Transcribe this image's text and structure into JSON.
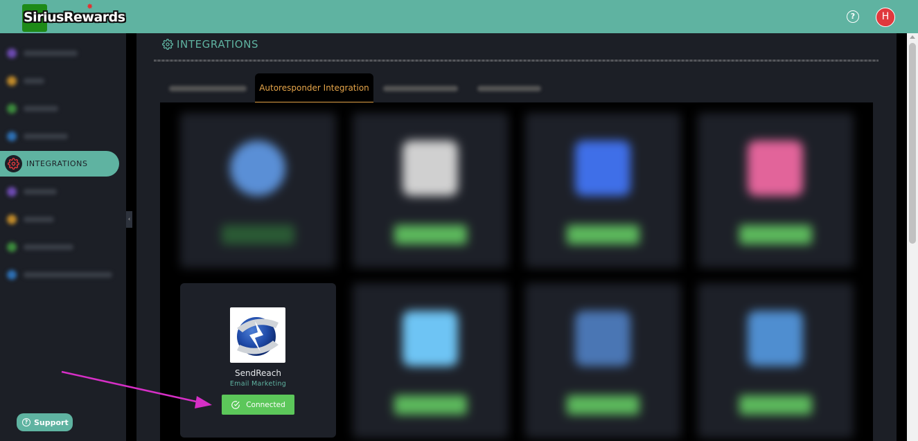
{
  "header": {
    "logo_text": "SiriusRewards",
    "avatar_initial": "H",
    "help_symbol": "?"
  },
  "sidebar": {
    "active_item": "INTEGRATIONS",
    "support_label": "Support"
  },
  "page": {
    "title": "INTEGRATIONS"
  },
  "tabs": {
    "active": "Autoresponder Integration"
  },
  "integration_card": {
    "name": "SendReach",
    "category": "Email Marketing",
    "button_label": "Connected"
  },
  "colors": {
    "accent": "#5fb3a1",
    "tab_active": "#e7a64a",
    "connected_green": "#5cc75a",
    "annotation_arrow": "#d62fc6"
  }
}
